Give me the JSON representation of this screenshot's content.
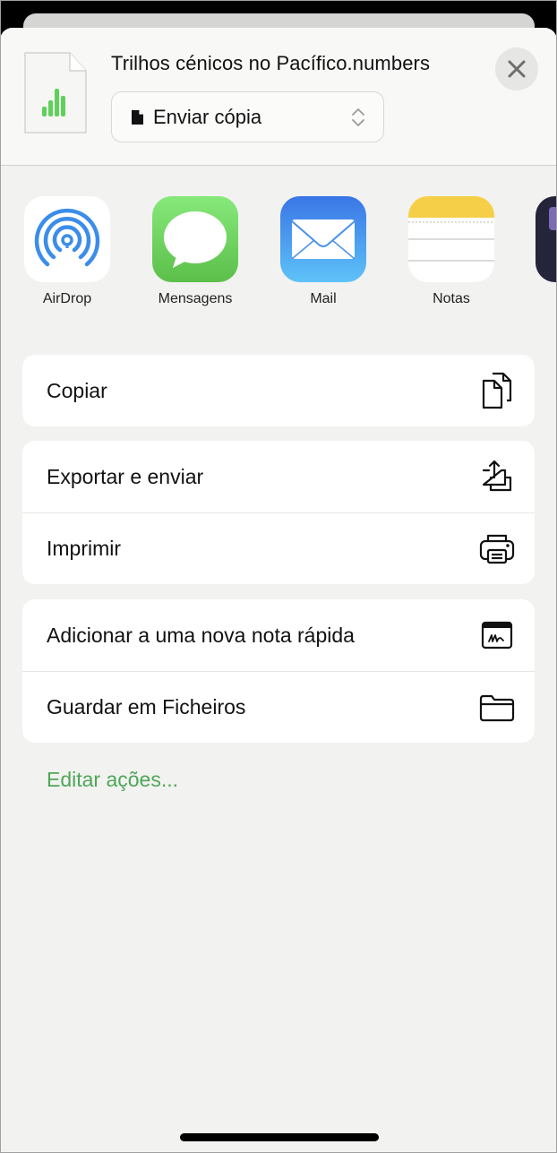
{
  "header": {
    "file_name": "Trilhos cénicos no Pacífico.numbers",
    "picker": {
      "label": "Enviar cópia"
    },
    "close_icon": "close-icon",
    "doc_icon": "numbers-document-icon"
  },
  "apps": [
    {
      "name": "AirDrop",
      "icon": "airdrop-icon"
    },
    {
      "name": "Mensagens",
      "icon": "messages-icon"
    },
    {
      "name": "Mail",
      "icon": "mail-icon"
    },
    {
      "name": "Notas",
      "icon": "notes-icon"
    },
    {
      "name": "",
      "icon": "partial-app-icon"
    }
  ],
  "action_groups": [
    [
      {
        "label": "Copiar",
        "icon": "copy-icon"
      }
    ],
    [
      {
        "label": "Exportar e enviar",
        "icon": "export-share-icon"
      },
      {
        "label": "Imprimir",
        "icon": "printer-icon"
      }
    ],
    [
      {
        "label": "Adicionar a uma nova nota rápida",
        "icon": "quick-note-icon"
      },
      {
        "label": "Guardar em Ficheiros",
        "icon": "folder-icon"
      }
    ]
  ],
  "edit_actions": "Editar ações...",
  "colors": {
    "accent": "#4ea65a",
    "background": "#f2f2f0"
  }
}
